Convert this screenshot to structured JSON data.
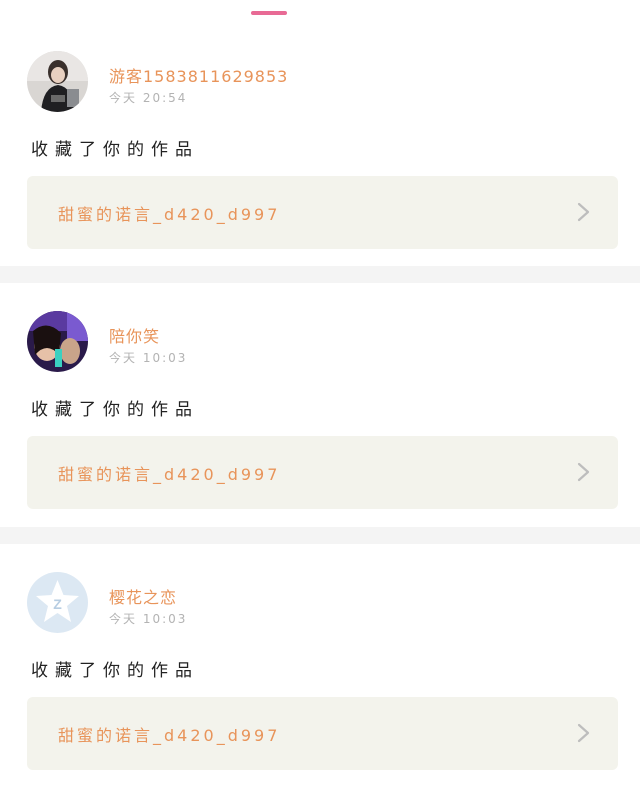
{
  "theme": {
    "accent": "#e86a95",
    "name_color": "#e8945a",
    "work_bg": "#f3f3ec",
    "chevron_color": "#bdbdbd"
  },
  "notifications": [
    {
      "username": "游客1583811629853",
      "time": "今天 20:54",
      "action": "收藏了你的作品",
      "work_title": "甜蜜的诺言_d420_d997",
      "avatar_icon": "photo-avatar-dark-hair"
    },
    {
      "username": "陪你笑",
      "time": "今天 10:03",
      "action": "收藏了你的作品",
      "work_title": "甜蜜的诺言_d420_d997",
      "avatar_icon": "photo-avatar-purple-neon"
    },
    {
      "username": "樱花之恋",
      "time": "今天 10:03",
      "action": "收藏了你的作品",
      "work_title": "甜蜜的诺言_d420_d997",
      "avatar_icon": "qq-default-avatar-icon"
    }
  ]
}
